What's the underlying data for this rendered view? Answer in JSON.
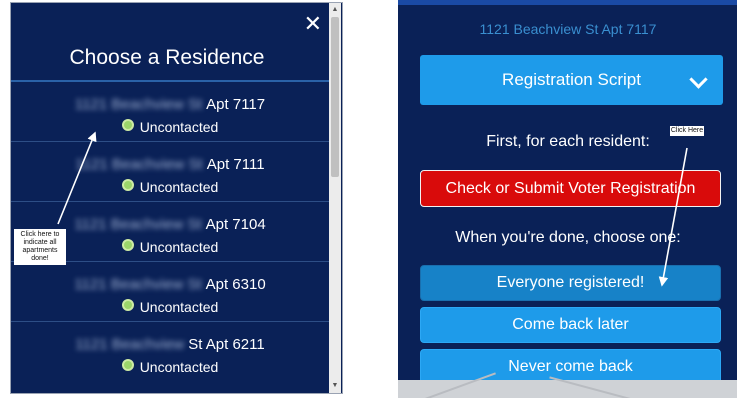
{
  "left": {
    "title": "Choose a Residence",
    "close_symbol": "✕",
    "annotation": "Click here to indicate all apartments done!",
    "residences": [
      {
        "address_blurred": "1121 Beachview St",
        "unit": "Apt 7117",
        "status": "Uncontacted"
      },
      {
        "address_blurred": "1121 Beachview St",
        "unit": "Apt 7111",
        "status": "Uncontacted"
      },
      {
        "address_blurred": "1121 Beachview St",
        "unit": "Apt 7104",
        "status": "Uncontacted"
      },
      {
        "address_blurred": "1121 Beachview St",
        "unit": "Apt 6310",
        "status": "Uncontacted"
      },
      {
        "address_blurred": "1121 Beachview",
        "unit": "St Apt 6211",
        "status": "Uncontacted"
      }
    ]
  },
  "right": {
    "address": "1121 Beachview St Apt 7117",
    "script_label": "Registration Script",
    "first_prompt": "First, for each resident:",
    "check_button": "Check or Submit Voter Registration",
    "done_prompt": "When you're done, choose one:",
    "options": [
      "Everyone registered!",
      "Come back later",
      "Never come back"
    ],
    "annotation": "Click Here"
  },
  "colors": {
    "panel_bg": "#0a2157",
    "accent_blue": "#1e9bea",
    "alert_red": "#d90b0b",
    "status_green": "#9bd46a"
  }
}
